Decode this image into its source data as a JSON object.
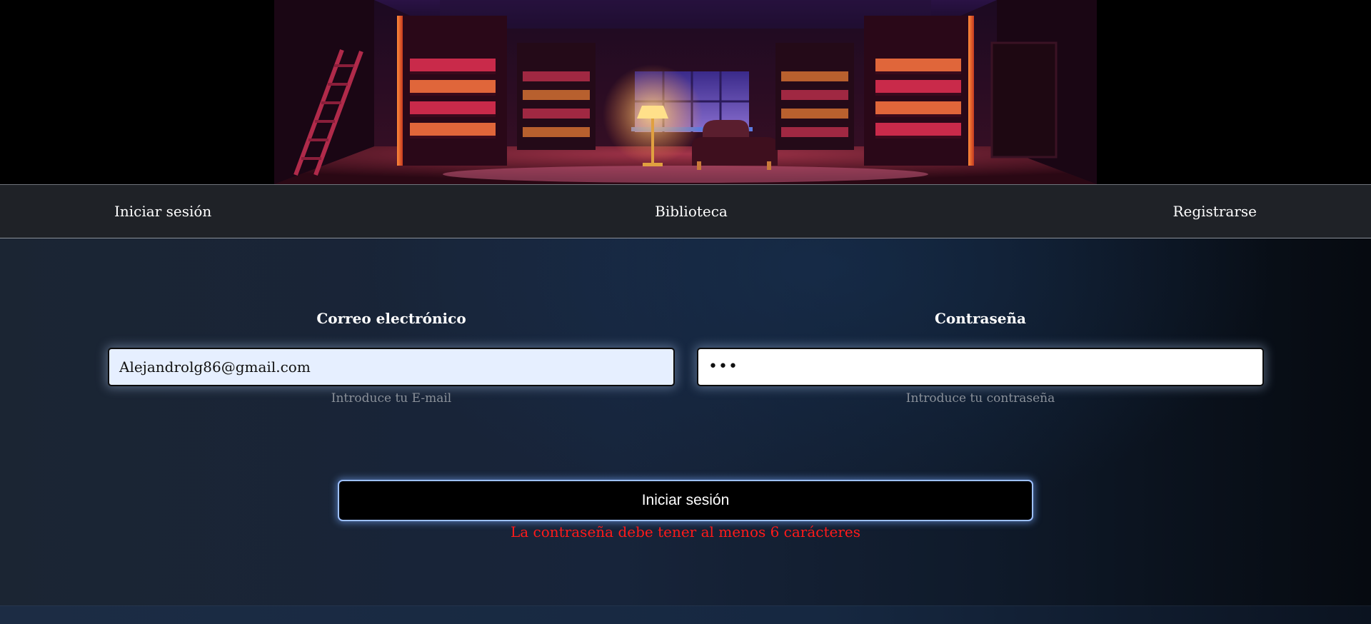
{
  "banner": {
    "image": "library-reading-room-illustration"
  },
  "nav": {
    "login": "Iniciar sesión",
    "library": "Biblioteca",
    "register": "Registrarse"
  },
  "form": {
    "email": {
      "label": "Correo electrónico",
      "value": "Alejandrolg86@gmail.com",
      "hint": "Introduce tu E-mail"
    },
    "password": {
      "label": "Contraseña",
      "value": "•••",
      "hint": "Introduce tu contraseña"
    },
    "submit_label": "Iniciar sesión",
    "error": "La contraseña debe tener al menos 6 carácteres"
  },
  "colors": {
    "nav_bg": "#1f2227",
    "error": "#ff1a1a",
    "button_border": "#9dc0ff",
    "email_field_bg": "#e6efff"
  }
}
